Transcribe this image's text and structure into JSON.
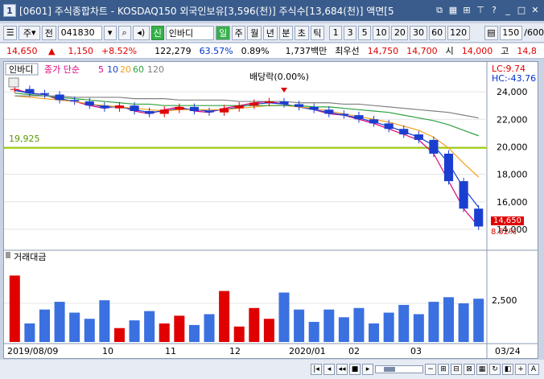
{
  "window": {
    "number": "1",
    "title": "[0601] 주식종합차트 - KOSDAQ150 외국인보유[3,596(천)] 주식수[13,684(천)] 액면[5"
  },
  "toolbar": {
    "market_select": "주",
    "prefix": "전",
    "code": "041830",
    "name_badge": "신",
    "stock_name": "인바디",
    "periods": [
      "일",
      "주",
      "월",
      "년",
      "분",
      "초",
      "틱"
    ],
    "selected_period": "일",
    "intervals": [
      "1",
      "3",
      "5",
      "10",
      "20",
      "30",
      "60",
      "120"
    ],
    "count": "150",
    "total": "/600"
  },
  "info": {
    "price": "14,650",
    "arrow": "▲",
    "change": "1,150",
    "change_pct": "+8.52%",
    "volume": "122,279",
    "vol_ratio": "63.57%",
    "turnover": "0.89%",
    "amount": "1,737백만",
    "best_offer_label": "최우선",
    "ask": "14,750",
    "bid": "14,700",
    "open_label": "시",
    "open": "14,000",
    "high_label": "고",
    "high": "14,8"
  },
  "chart": {
    "stock_label": "인바디",
    "ma_label": "종가 단순",
    "ma_periods": [
      "5",
      "10",
      "20",
      "60",
      "120"
    ],
    "ma_colors": [
      "#e0007a",
      "#1a3fd0",
      "#f0a020",
      "#2ea040",
      "#808080"
    ],
    "lc": "LC:9.74",
    "hc": "HC:-43.76",
    "dividend_note": "배당락(0.00%)",
    "support_level": "19,925",
    "current_price_label": "14,650",
    "current_pct_label": "8.52%",
    "y_ticks": [
      "24,000",
      "22,000",
      "20,000",
      "18,000",
      "16,000",
      "14,000"
    ],
    "volume_title": "거래대금",
    "volume_tick": "2,500",
    "x_labels": [
      "2019/08/09",
      "10",
      "11",
      "12",
      "2020/01",
      "02",
      "03",
      "03/24"
    ]
  },
  "chart_data": {
    "type": "candlestick",
    "title": "인바디",
    "ylim": [
      13000,
      25000
    ],
    "support_line": 19925,
    "last_price": 14650,
    "last_change_pct": 8.52,
    "series": [
      {
        "name": "5",
        "values": [
          24200,
          23900,
          23800,
          23400,
          23300,
          23000,
          22800,
          23000,
          22600,
          22400,
          22700,
          22900,
          22600,
          22500,
          22800,
          23000,
          23200,
          23300,
          23100,
          22900,
          22700,
          22400,
          22300,
          22000,
          21700,
          21300,
          20900,
          20500,
          19500,
          17500,
          15500,
          14200
        ]
      },
      {
        "name": "10",
        "values": [
          24100,
          23900,
          23800,
          23500,
          23300,
          23100,
          22900,
          22900,
          22700,
          22500,
          22600,
          22800,
          22700,
          22600,
          22700,
          22900,
          23100,
          23200,
          23100,
          22900,
          22700,
          22500,
          22300,
          22100,
          21800,
          21500,
          21100,
          20700,
          20100,
          18800,
          17000,
          15600
        ]
      },
      {
        "name": "20",
        "values": [
          23700,
          23600,
          23500,
          23400,
          23300,
          23100,
          23000,
          22900,
          22800,
          22700,
          22600,
          22700,
          22700,
          22700,
          22700,
          22800,
          22900,
          23000,
          23000,
          22900,
          22800,
          22600,
          22400,
          22200,
          22000,
          21800,
          21500,
          21200,
          20700,
          19900,
          18800,
          17800
        ]
      },
      {
        "name": "60",
        "values": [
          23900,
          23800,
          23700,
          23600,
          23500,
          23400,
          23300,
          23200,
          23100,
          23100,
          23000,
          23000,
          23000,
          23000,
          23000,
          23000,
          23000,
          23000,
          23000,
          23000,
          22900,
          22900,
          22800,
          22700,
          22600,
          22500,
          22300,
          22100,
          21900,
          21600,
          21200,
          20800
        ]
      },
      {
        "name": "120",
        "values": [
          23700,
          23700,
          23700,
          23700,
          23600,
          23600,
          23600,
          23600,
          23500,
          23500,
          23500,
          23400,
          23400,
          23400,
          23400,
          23300,
          23300,
          23300,
          23300,
          23200,
          23200,
          23200,
          23100,
          23100,
          23000,
          22900,
          22800,
          22700,
          22600,
          22500,
          22300,
          22100
        ]
      }
    ],
    "volume": {
      "name": "거래대금",
      "ylim": [
        0,
        5000
      ],
      "values": [
        4300,
        1200,
        2100,
        2600,
        1900,
        1500,
        2700,
        900,
        1400,
        2000,
        1200,
        1700,
        1100,
        1800,
        3300,
        1000,
        2200,
        1500,
        3200,
        2100,
        1300,
        2100,
        1600,
        2200,
        1200,
        1900,
        2400,
        1800,
        2600,
        2900,
        2500,
        2800
      ]
    }
  }
}
